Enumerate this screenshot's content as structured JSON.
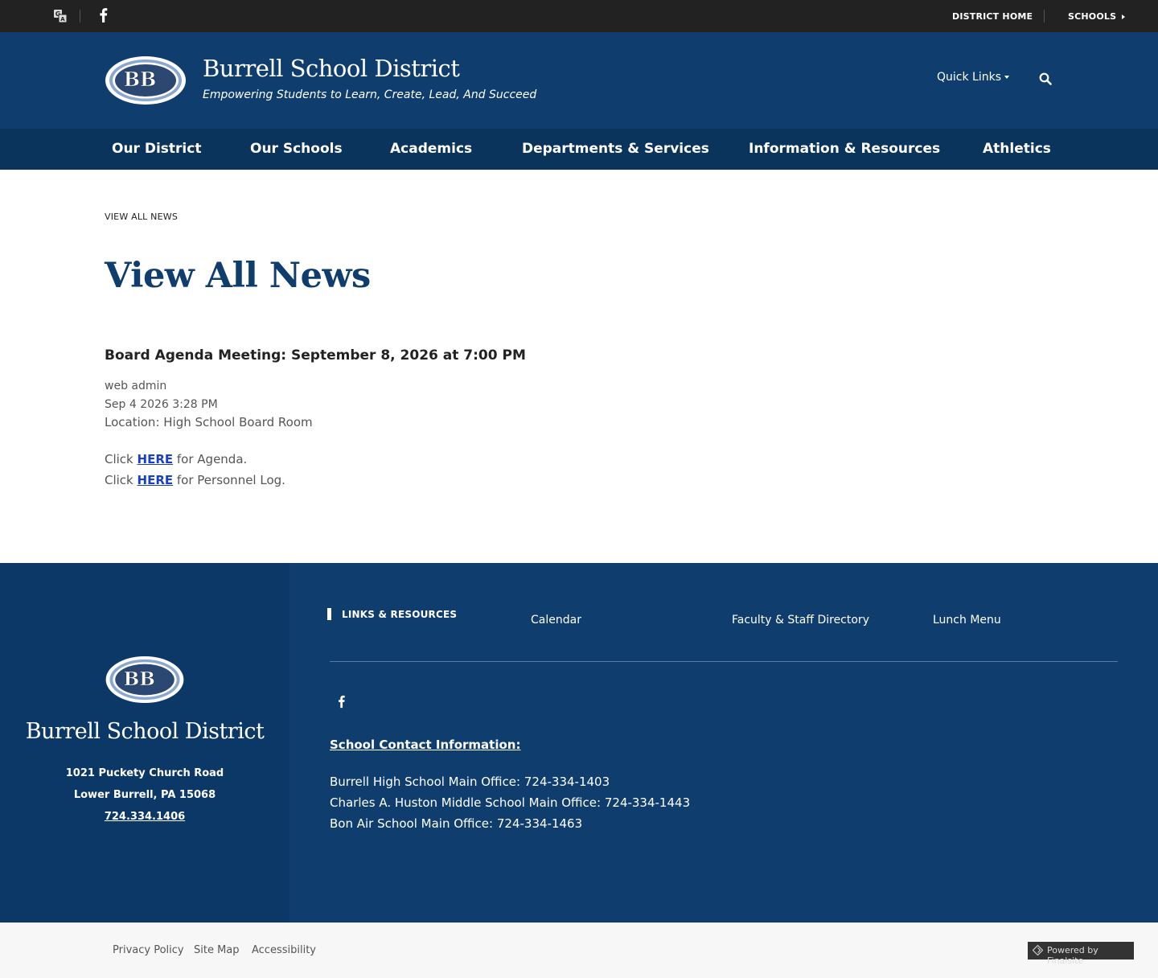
{
  "topbar": {
    "translate_icon": "translate-icon",
    "facebook_icon": "facebook-icon",
    "district_home": "DISTRICT HOME",
    "schools": "SCHOOLS"
  },
  "header": {
    "logo_text": "BB",
    "title": "Burrell School District",
    "tagline": "Empowering Students to Learn, Create, Lead, And Succeed",
    "quick_links": "Quick Links",
    "search_icon": "search-icon"
  },
  "nav": {
    "items": [
      {
        "label": "Our District"
      },
      {
        "label": "Our Schools"
      },
      {
        "label": "Academics"
      },
      {
        "label": "Departments & Services"
      },
      {
        "label": "Information & Resources"
      },
      {
        "label": "Athletics"
      }
    ]
  },
  "content": {
    "breadcrumb": "VIEW ALL NEWS",
    "page_title": "View All News",
    "news": {
      "title": "Board Agenda Meeting: September 8, 2026 at 7:00 PM",
      "author": "web admin",
      "date": "Sep 4 2026 3:28 PM",
      "location": "Location: High School Board Room",
      "line1_pre": "Click ",
      "line1_link": "HERE",
      "line1_post": " for Agenda.",
      "line2_pre": "Click ",
      "line2_link": "HERE",
      "line2_post": " for Personnel Log."
    }
  },
  "footer": {
    "brand": "Burrell School District",
    "address1": "1021 Puckety Church Road",
    "address2": "Lower Burrell, PA  15068",
    "phone": "724.334.1406",
    "links_title": "LINKS & RESOURCES",
    "links": [
      {
        "label": "Calendar"
      },
      {
        "label": "Faculty & Staff Directory"
      },
      {
        "label": "Lunch Menu"
      }
    ],
    "contact_heading": "School Contact Information:",
    "contacts": [
      "Burrell High School Main Office:  724-334-1403",
      "Charles A. Huston Middle School Main Office:  724-334-1443",
      "Bon Air School Main Office:  724-334-1463"
    ]
  },
  "bottom": {
    "privacy": "Privacy Policy",
    "sitemap": "Site Map",
    "accessibility": "Accessibility",
    "powered": "Powered by Finalsite"
  },
  "colors": {
    "header_blue": "#0f3e6e",
    "nav_blue": "#0b345d",
    "footer_left_blue": "#0b3866",
    "topbar": "#222222",
    "link_blue": "#1a3fc4"
  }
}
